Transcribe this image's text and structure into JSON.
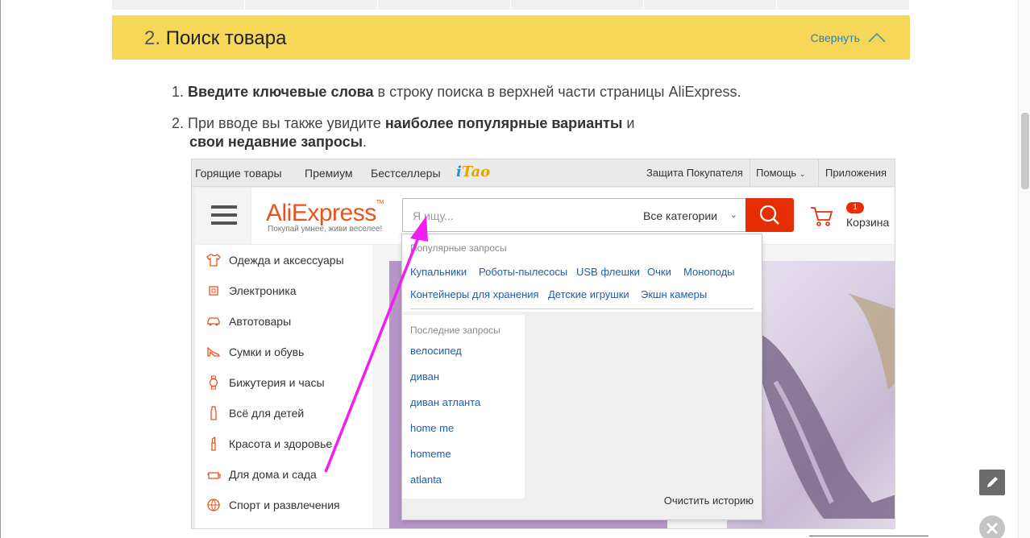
{
  "section": {
    "number": "2.",
    "title": "Поиск товара",
    "collapse": "Свернуть"
  },
  "steps": [
    {
      "n": "1.",
      "bold": "Введите ключевые слова",
      "rest": "в строку поиска в верхней части страницы AliExpress."
    },
    {
      "n": "2.",
      "pre": "При вводе вы также увидите",
      "bold": "наиболее популярные варианты",
      "mid": "и",
      "bold2": "свои недавние запросы",
      "end": "."
    }
  ],
  "ali": {
    "topbar_left": [
      "Горящие товары",
      "Премиум",
      "Бестселлеры"
    ],
    "tao": {
      "i": "i",
      "rest": "Tao"
    },
    "topbar_right": [
      "Защита Покупателя",
      "Помощь",
      "Приложения"
    ],
    "logo": "AliExpress",
    "tm": "TM",
    "tagline": "Покупай умнее, живи веселее!",
    "search_placeholder": "Я ищу...",
    "category": "Все категории",
    "cart_count": "1",
    "cart_label": "Корзина",
    "categories": [
      "Одежда и аксессуары",
      "Электроника",
      "Автотовары",
      "Сумки и обувь",
      "Бижутерия и часы",
      "Всё для детей",
      "Красота и здоровье",
      "Для дома и сада",
      "Спорт и развлечения"
    ],
    "popular_title": "Популярные запросы",
    "popular_row1": [
      "Купальники",
      "Роботы-пылесосы",
      "USB флешки",
      "Очки",
      "Моноподы"
    ],
    "popular_row2": [
      "Контейнеры для хранения",
      "Детские игрушки",
      "Экшн камеры"
    ],
    "recent_title": "Последние запросы",
    "recent": [
      "велосипед",
      "диван",
      "диван атланта",
      "home me",
      "homeme",
      "atlanta"
    ],
    "clear": "Очистить историю"
  },
  "colors": {
    "section_bg": "#f7d758",
    "accent_link": "#2a7fc4",
    "ali_orange": "#e8531d",
    "ali_red": "#e62e04",
    "annotation_arrow": "#f01ef0"
  }
}
